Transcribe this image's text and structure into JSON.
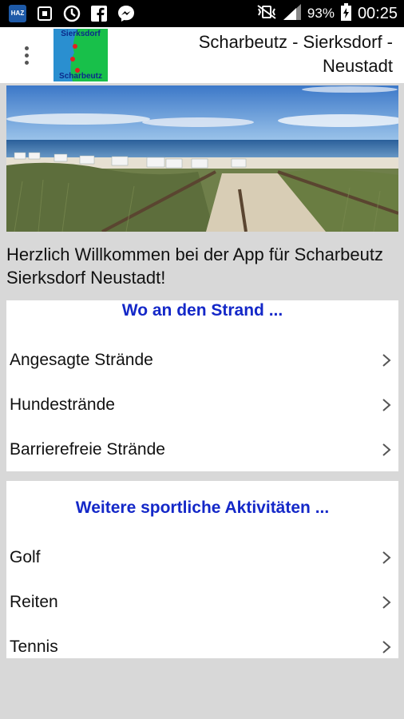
{
  "status_bar": {
    "icons": [
      "haz-app-icon",
      "screenshot-icon",
      "sync-icon",
      "facebook-icon",
      "messenger-icon"
    ],
    "haz_label": "HAZ",
    "battery": "93%",
    "time": "00:25"
  },
  "app_bar": {
    "logo_top": "Sierksdorf",
    "logo_bottom": "Scharbeutz",
    "title": "Scharbeutz - Sierksdorf - Neustadt"
  },
  "welcome": "Herzlich Willkommen bei der App für Scharbeutz Sierksdorf Neustadt!",
  "sections": [
    {
      "title": "Wo an den Strand ...",
      "items": [
        {
          "label": "Angesagte Strände"
        },
        {
          "label": "Hundestrände"
        },
        {
          "label": "Barrierefreie Strände"
        }
      ]
    },
    {
      "title": "Weitere sportliche Aktivitäten ...",
      "items": [
        {
          "label": "Golf"
        },
        {
          "label": "Reiten"
        },
        {
          "label": "Tennis"
        }
      ]
    }
  ],
  "colors": {
    "section_title": "#1428c8",
    "background": "#d8d8d8",
    "status_bar": "#000000"
  }
}
